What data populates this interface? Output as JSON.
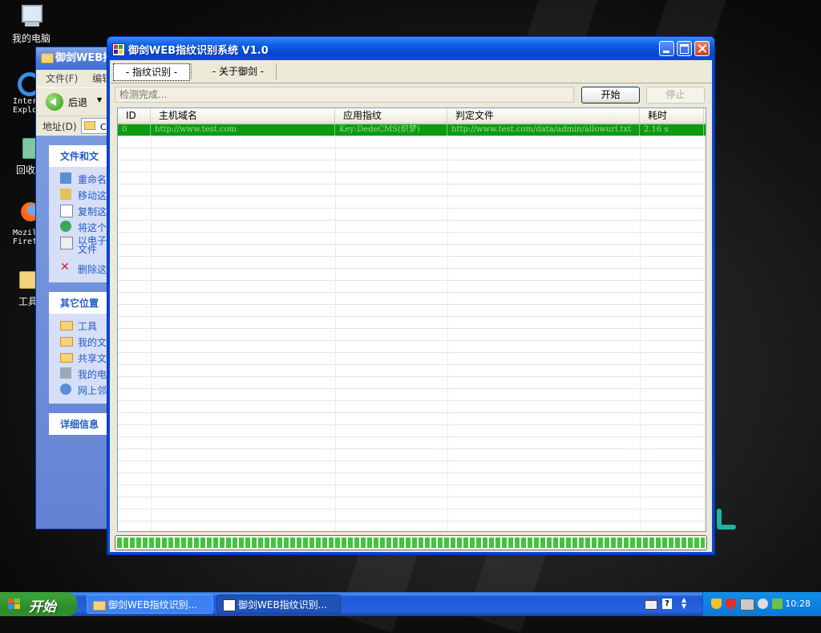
{
  "desktop": {
    "icons": [
      {
        "label": "我的电脑"
      },
      {
        "label": "Inter Explo"
      },
      {
        "label": "回收"
      },
      {
        "label": "Mozil Firef"
      },
      {
        "label": "工具"
      }
    ]
  },
  "explorer": {
    "title": "御剑WEB指",
    "menu": [
      "文件(F)",
      "编辑"
    ],
    "back_label": "后退",
    "address_label": "地址(D)",
    "address_value": "C:",
    "task_panel": {
      "title": "文件和文",
      "items": [
        "重命名",
        "移动这",
        "复制这",
        "将这个",
        "以电子\n文件",
        "删除这"
      ]
    },
    "other_places": {
      "title": "其它位置",
      "items": [
        "工具",
        "我的文",
        "共享文",
        "我的电",
        "网上邻"
      ]
    },
    "details": {
      "title": "详细信息"
    }
  },
  "app": {
    "title": "御剑WEB指纹识别系统 V1.0",
    "tabs": [
      {
        "label": "- 指纹识别 -",
        "active": true
      },
      {
        "label": "- 关于御剑 -",
        "active": false
      }
    ],
    "status": {
      "placeholder": "检测完成..."
    },
    "buttons": {
      "start": "开始",
      "stop": "停止"
    },
    "table": {
      "columns": [
        "ID",
        "主机域名",
        "应用指纹",
        "判定文件",
        "耗时"
      ],
      "rows": [
        {
          "id": "0",
          "host": "http://www.test.com",
          "fingerprint": "Key:DedeCMS(织梦)",
          "file": "http://www.test.com/data/admin/allowurl.txt",
          "time": "2.16 s"
        }
      ],
      "row_color": "#0d9b11"
    },
    "progress": 1.0
  },
  "taskbar": {
    "start_label": "开始",
    "tasks": [
      {
        "label": "御剑WEB指纹识别...",
        "active": false
      },
      {
        "label": "御剑WEB指纹识别...",
        "active": true
      }
    ],
    "clock": "10:28"
  }
}
